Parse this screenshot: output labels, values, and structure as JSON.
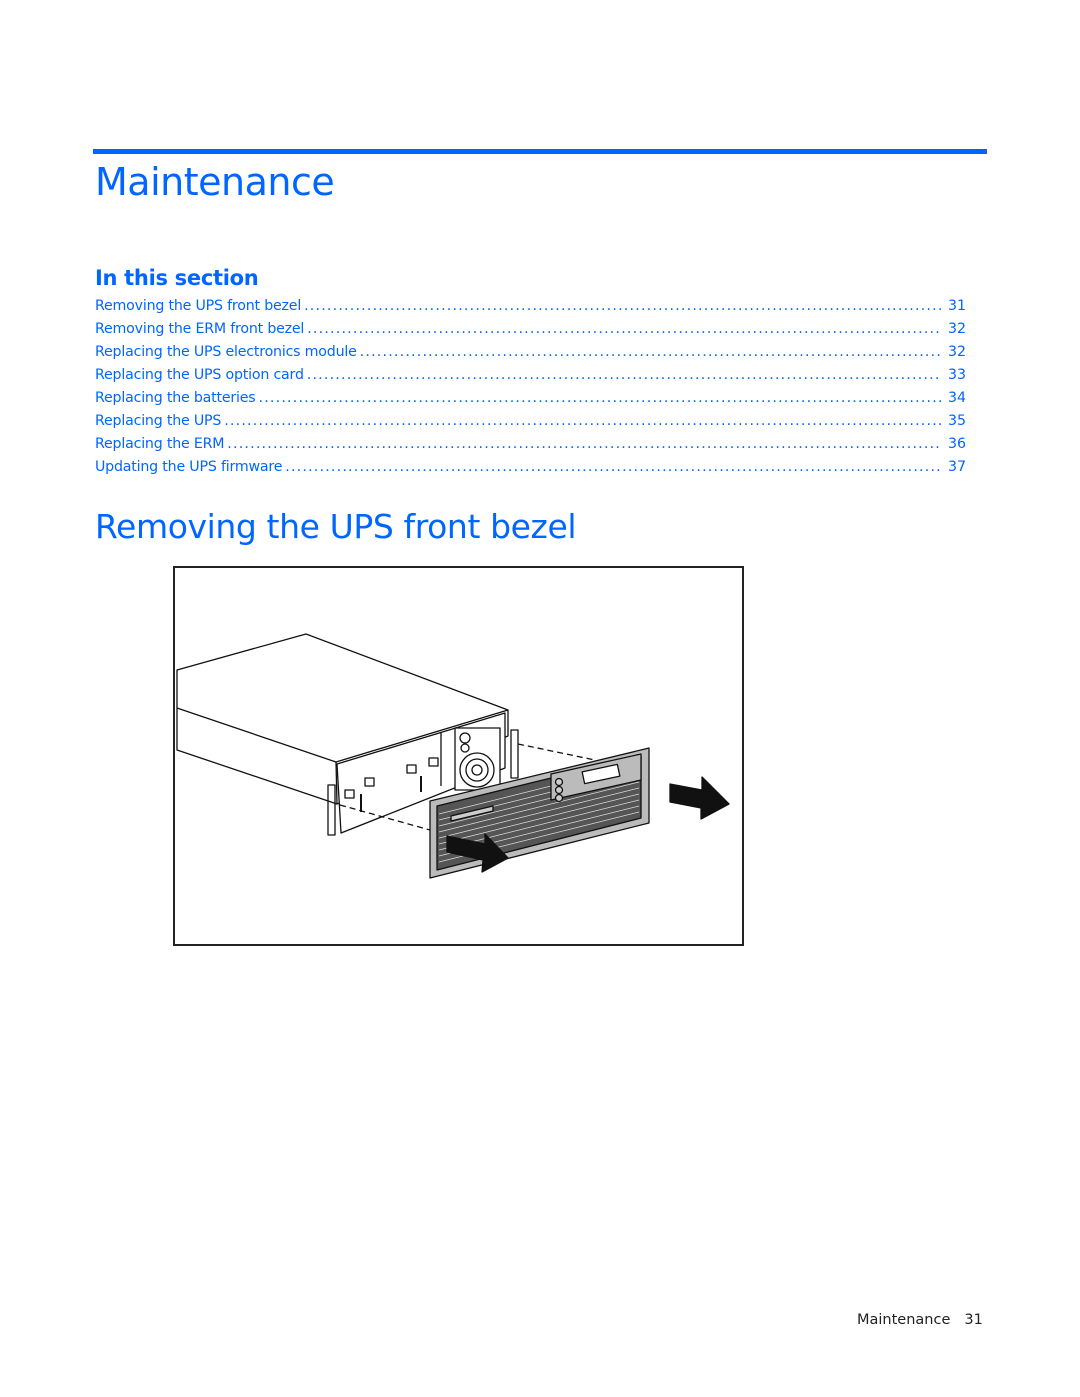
{
  "chapter": {
    "title": "Maintenance",
    "accent_color": "#0066ff"
  },
  "in_this_section": {
    "label": "In this section",
    "items": [
      {
        "title": "Removing the UPS front bezel",
        "page": "31"
      },
      {
        "title": "Removing the ERM front bezel",
        "page": "32"
      },
      {
        "title": "Replacing the UPS electronics module",
        "page": "32"
      },
      {
        "title": "Replacing the UPS option card",
        "page": "33"
      },
      {
        "title": "Replacing the batteries",
        "page": "34"
      },
      {
        "title": "Replacing the UPS",
        "page": "35"
      },
      {
        "title": "Replacing the ERM",
        "page": "36"
      },
      {
        "title": "Updating the UPS firmware",
        "page": "37"
      }
    ]
  },
  "section": {
    "title": "Removing the UPS front bezel",
    "figure": {
      "description": "UPS unit with front bezel being pulled off toward the viewer; arrows indicate removal direction",
      "icons": [
        "ups-chassis-icon",
        "front-bezel-icon",
        "arrow-right-icon"
      ]
    }
  },
  "footer": {
    "chapter": "Maintenance",
    "page_number": "31"
  }
}
